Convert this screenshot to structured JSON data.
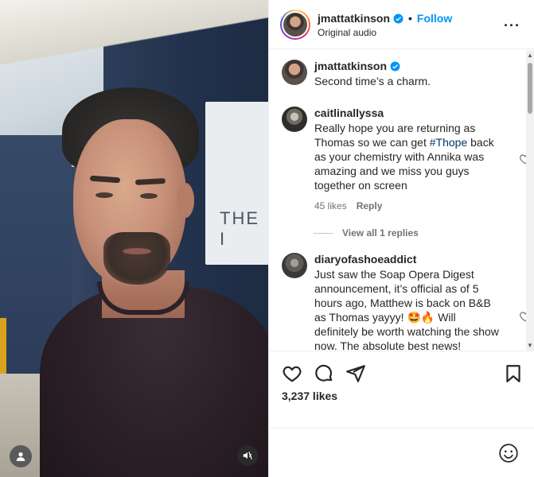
{
  "media": {
    "sign_text": "THE I",
    "user_tag_icon": "person-icon",
    "mute_icon": "speaker-muted-icon"
  },
  "post": {
    "username": "jmattatkinson",
    "follow_label": "Follow",
    "audio_label": "Original audio",
    "more_icon": "more-horizontal-icon",
    "separator": "•"
  },
  "comments": [
    {
      "username": "jmattatkinson",
      "verified": true,
      "text": "Second time’s a charm."
    },
    {
      "username": "caitlinallyssa",
      "text_before": "Really hope you are returning as Thomas so we can get ",
      "hashtag": "#Thope",
      "text_after": " back as your chemistry with Annika was amazing and we miss you guys together on screen",
      "likes": "45 likes",
      "reply_label": "Reply",
      "view_replies": "View all 1 replies"
    },
    {
      "username": "diaryofashoeaddict",
      "text": "Just saw the Soap Opera Digest announcement, it’s official as of 5 hours ago, Matthew is back on B&B as Thomas yayyy! 🤩🔥 Will definitely be worth watching the show now. The absolute best news!"
    }
  ],
  "actions": {
    "like_icon": "heart-icon",
    "comment_icon": "comment-icon",
    "share_icon": "send-icon",
    "save_icon": "bookmark-icon",
    "likes_count": "3,237 likes",
    "emoji_icon": "emoji-icon"
  },
  "colors": {
    "accent": "#0095f6",
    "hashtag": "#00376b",
    "muted_text": "#737373"
  }
}
